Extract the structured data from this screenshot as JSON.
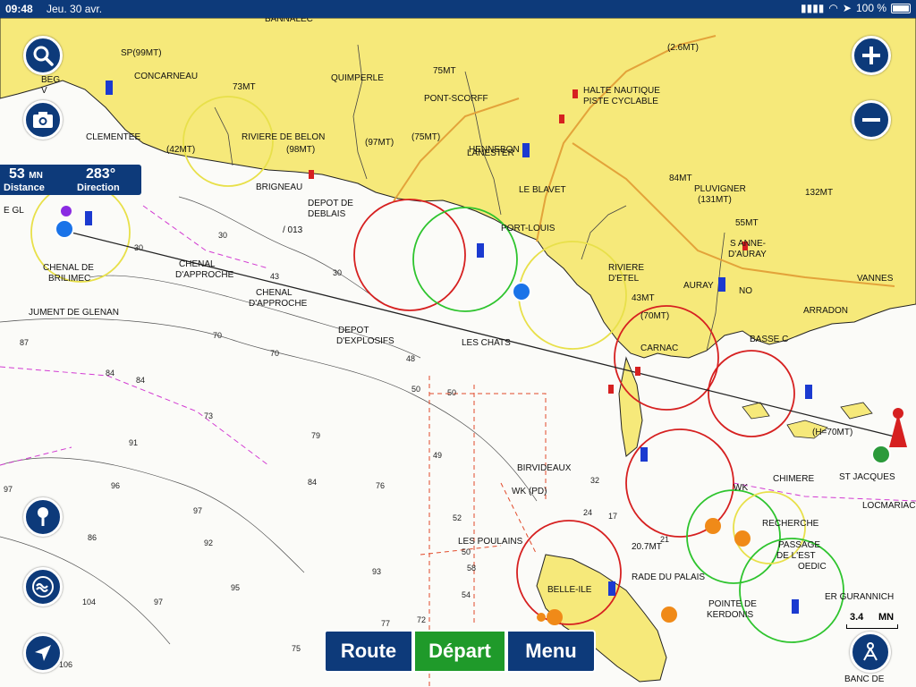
{
  "status_bar": {
    "time": "09:48",
    "date": "Jeu. 30 avr.",
    "battery": "100 %"
  },
  "nav_readout": {
    "distance_value": "53",
    "distance_unit": "MN",
    "distance_label": "Distance",
    "direction_value": "283°",
    "direction_label": "Direction"
  },
  "bottom_bar": {
    "route_label": "Route",
    "depart_label": "Départ",
    "menu_label": "Menu"
  },
  "scale": {
    "value": "3.4",
    "unit": "MN"
  },
  "colors": {
    "ui_blue": "#0d3a7a",
    "depart_green": "#1f9a2a",
    "land": "#f6e97a",
    "water": "#fbfbf8"
  },
  "map_labels": [
    "BANNALEC",
    "QUIMPERLE",
    "CONCARNEAU",
    "SP(99MT)",
    "75MT",
    "73MT",
    "(2.6MT)",
    "PONT-SCORFF",
    "HALTE NAUTIQUE",
    "PISTE CYCLABLE",
    "RIVIERE DE BELON",
    "(98MT)",
    "(42MT)",
    "(97MT)",
    "(75MT)",
    "HENNEBON",
    "LANESTER",
    "LE BLAVET",
    "84MT",
    "PLUVIGNER",
    "(131MT)",
    "132MT",
    "55MT",
    "BRIGNEAU",
    "DEPOT DE",
    "DEBLAIS",
    "PORT-LOUIS",
    "S ANNE-",
    "D'AURAY",
    "VANNES",
    "CHENAL",
    "D'APPROCHE",
    "CHENAL",
    "D'APPROCHE",
    "RIVIERE",
    "D'ETEL",
    "AURAY",
    "43MT",
    "NO",
    "ARRADON",
    "CHENAL DE",
    "BRILIMEC",
    "JUMENT DE GLENAN",
    "DEPOT",
    "D'EXPLOSIFS",
    "LES CHATS",
    "CARNAC",
    "(70MT)",
    "BASSE C",
    "(H=70MT)",
    "BIRVIDEAUX",
    "WK (PD)",
    "WK",
    "CHIMERE",
    "ST JACQUES",
    "LOCMARIAC",
    "RECHERCHE",
    "PASSAGE",
    "DE L'EST",
    "OEDIC",
    "LES POULAINS",
    "20.7MT",
    "ER GURANNICH",
    "BELLE-ILE",
    "RADE DU PALAIS",
    "POINTE DE",
    "KERDONIS",
    "BANC DE",
    "/ 013",
    "CLEMENTEE",
    "BEG",
    "V",
    "E GL"
  ],
  "depth_soundings": [
    "30",
    "30",
    "30",
    "43",
    "48",
    "50",
    "50",
    "70",
    "70",
    "73",
    "79",
    "76",
    "84",
    "84",
    "87",
    "91",
    "92",
    "93",
    "95",
    "96",
    "97",
    "97",
    "97",
    "104",
    "106",
    "77",
    "58",
    "54",
    "72",
    "75",
    "84",
    "86",
    "49",
    "50",
    "52",
    "21",
    "24",
    "32",
    "17"
  ]
}
